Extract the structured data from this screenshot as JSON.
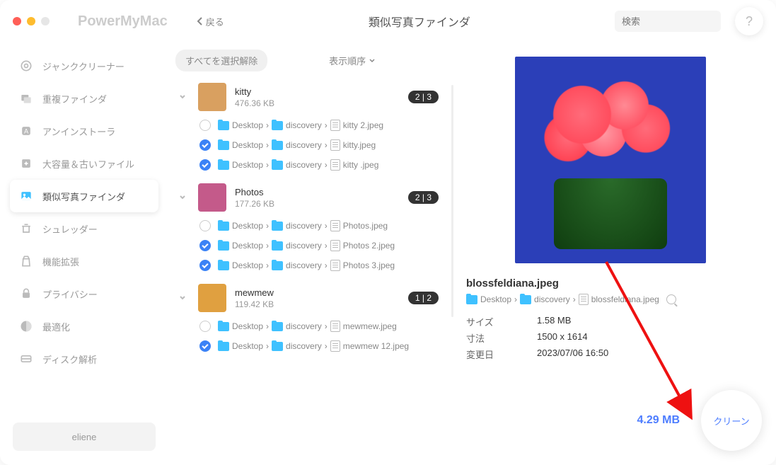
{
  "header": {
    "brand": "PowerMyMac",
    "back": "戻る",
    "title": "類似写真ファインダ",
    "search_placeholder": "検索"
  },
  "traffic": {
    "close": "#ff5f57",
    "min": "#febc2e",
    "max": "#e6e6e6"
  },
  "sidebar": {
    "items": [
      {
        "label": "ジャンククリーナー"
      },
      {
        "label": "重複ファインダ"
      },
      {
        "label": "アンインストーラ"
      },
      {
        "label": "大容量＆古いファイル"
      },
      {
        "label": "類似写真ファインダ"
      },
      {
        "label": "シュレッダー"
      },
      {
        "label": "機能拡張"
      },
      {
        "label": "プライバシー"
      },
      {
        "label": "最適化"
      },
      {
        "label": "ディスク解析"
      }
    ],
    "user": "eliene"
  },
  "list": {
    "deselect": "すべてを選択解除",
    "sort": "表示順序",
    "groups": [
      {
        "name": "kitty",
        "size": "476.36 KB",
        "badge": "2 | 3",
        "files": [
          {
            "checked": false,
            "seg1": "Desktop",
            "seg2": "discovery",
            "fname": "kitty 2.jpeg"
          },
          {
            "checked": true,
            "seg1": "Desktop",
            "seg2": "discovery",
            "fname": "kitty.jpeg"
          },
          {
            "checked": true,
            "seg1": "Desktop",
            "seg2": "discovery",
            "fname": "kitty .jpeg"
          }
        ]
      },
      {
        "name": "Photos",
        "size": "177.26 KB",
        "badge": "2 | 3",
        "files": [
          {
            "checked": false,
            "seg1": "Desktop",
            "seg2": "discovery",
            "fname": "Photos.jpeg"
          },
          {
            "checked": true,
            "seg1": "Desktop",
            "seg2": "discovery",
            "fname": "Photos 2.jpeg"
          },
          {
            "checked": true,
            "seg1": "Desktop",
            "seg2": "discovery",
            "fname": "Photos 3.jpeg"
          }
        ]
      },
      {
        "name": "mewmew",
        "size": "119.42 KB",
        "badge": "1 | 2",
        "files": [
          {
            "checked": false,
            "seg1": "Desktop",
            "seg2": "discovery",
            "fname": "mewmew.jpeg"
          },
          {
            "checked": true,
            "seg1": "Desktop",
            "seg2": "discovery",
            "fname": "mewmew 12.jpeg"
          }
        ]
      }
    ]
  },
  "preview": {
    "name": "blossfeldiana.jpeg",
    "path": {
      "seg1": "Desktop",
      "seg2": "discovery",
      "fname": "blossfeldiana.jpeg"
    },
    "rows": [
      {
        "label": "サイズ",
        "value": "1.58 MB"
      },
      {
        "label": "寸法",
        "value": "1500 x 1614"
      },
      {
        "label": "変更日",
        "value": "2023/07/06 16:50"
      }
    ]
  },
  "footer": {
    "total": "4.29 MB",
    "clean": "クリーン"
  },
  "thumb_colors": [
    "#d9a060",
    "#c45a8a",
    "#e0a040"
  ]
}
